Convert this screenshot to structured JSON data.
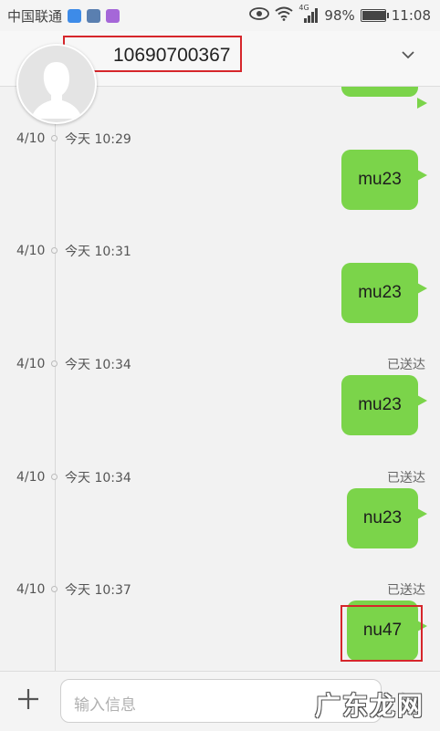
{
  "status_bar": {
    "carrier": "中国联通",
    "network": "4G",
    "battery": "98%",
    "battery_level": 0.98,
    "time": "11:08",
    "app_icon_colors": [
      "#3d8be8",
      "#5a7fb0",
      "#a567d8"
    ]
  },
  "header": {
    "contact_number": "10690700367",
    "expand_icon": "chevron-down-icon"
  },
  "messages": [
    {
      "date": "4/10",
      "time": "今天 10:29",
      "status": "",
      "text": "mu23"
    },
    {
      "date": "4/10",
      "time": "今天 10:31",
      "status": "",
      "text": "mu23"
    },
    {
      "date": "4/10",
      "time": "今天 10:34",
      "status": "已送达",
      "text": "mu23"
    },
    {
      "date": "4/10",
      "time": "今天 10:34",
      "status": "已送达",
      "text": "nu23"
    },
    {
      "date": "4/10",
      "time": "今天 10:37",
      "status": "已送达",
      "text": "nu47"
    }
  ],
  "input_bar": {
    "add_icon": "plus-icon",
    "placeholder": "输入信息",
    "send_icon": "send-icon"
  },
  "watermark": "广东龙网",
  "colors": {
    "bubble": "#7bd44a",
    "highlight": "#d6262b",
    "background": "#f2f2f2"
  }
}
